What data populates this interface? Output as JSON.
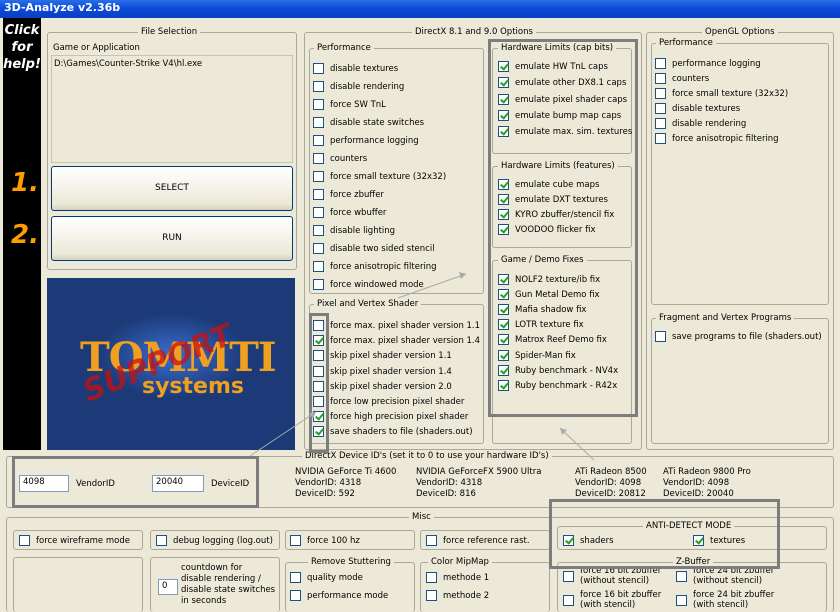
{
  "window": {
    "title": "3D-Analyze v2.36b"
  },
  "sidebar": {
    "help_lines": [
      "Click",
      "for",
      "help!"
    ],
    "step1": "1.",
    "step2": "2."
  },
  "file_selection": {
    "title": "File Selection",
    "label": "Game or Application",
    "path": "D:\\Games\\Counter-Strike V4\\hl.exe",
    "select_button": "SELECT",
    "run_button": "RUN"
  },
  "logo": {
    "main": "TOMMTI",
    "sub": "systems",
    "stamp": "SUPPORT"
  },
  "dx": {
    "title": "DirectX 8.1 and 9.0 Options",
    "performance": {
      "title": "Performance",
      "items": [
        {
          "label": "disable textures",
          "checked": false
        },
        {
          "label": "disable rendering",
          "checked": false
        },
        {
          "label": "force SW TnL",
          "checked": false
        },
        {
          "label": "disable state switches",
          "checked": false
        },
        {
          "label": "performance logging",
          "checked": false
        },
        {
          "label": "counters",
          "checked": false
        },
        {
          "label": "force small texture (32x32)",
          "checked": false
        },
        {
          "label": "force zbuffer",
          "checked": false
        },
        {
          "label": "force wbuffer",
          "checked": false
        },
        {
          "label": "disable lighting",
          "checked": false
        },
        {
          "label": "disable two sided stencil",
          "checked": false
        },
        {
          "label": "force anisotropic filtering",
          "checked": false
        },
        {
          "label": "force windowed mode",
          "checked": false
        }
      ]
    },
    "shader": {
      "title": "Pixel and Vertex Shader",
      "items": [
        {
          "label": "force max. pixel shader version 1.1",
          "checked": false
        },
        {
          "label": "force max. pixel shader version 1.4",
          "checked": true
        },
        {
          "label": "skip pixel shader version 1.1",
          "checked": false
        },
        {
          "label": "skip pixel shader version 1.4",
          "checked": false
        },
        {
          "label": "skip pixel shader version 2.0",
          "checked": false
        },
        {
          "label": "force low precision pixel shader",
          "checked": false
        },
        {
          "label": "force high precision pixel shader",
          "checked": true
        },
        {
          "label": "save shaders to file (shaders.out)",
          "checked": true
        }
      ]
    },
    "caps": {
      "title": "Hardware Limits (cap bits)",
      "items": [
        {
          "label": "emulate HW TnL caps",
          "checked": true
        },
        {
          "label": "emulate other DX8.1 caps",
          "checked": true
        },
        {
          "label": "emulate pixel shader caps",
          "checked": true
        },
        {
          "label": "emulate bump map caps",
          "checked": true
        },
        {
          "label": "emulate max. sim. textures",
          "checked": true
        }
      ]
    },
    "features": {
      "title": "Hardware Limits (features)",
      "items": [
        {
          "label": "emulate cube maps",
          "checked": true
        },
        {
          "label": "emulate DXT textures",
          "checked": true
        },
        {
          "label": "KYRO zbuffer/stencil fix",
          "checked": true
        },
        {
          "label": "VOODOO flicker fix",
          "checked": true
        }
      ]
    },
    "fixes": {
      "title": "Game / Demo Fixes",
      "items": [
        {
          "label": "NOLF2 texture/ib fix",
          "checked": true
        },
        {
          "label": "Gun Metal Demo fix",
          "checked": true
        },
        {
          "label": "Mafia shadow fix",
          "checked": true
        },
        {
          "label": "LOTR texture fix",
          "checked": true
        },
        {
          "label": "Matrox Reef Demo fix",
          "checked": true
        },
        {
          "label": "Spider-Man fix",
          "checked": true
        },
        {
          "label": "Ruby benchmark - NV4x",
          "checked": true
        },
        {
          "label": "Ruby benchmark - R42x",
          "checked": true
        }
      ]
    }
  },
  "opengl": {
    "title": "OpenGL Options",
    "performance": {
      "title": "Performance",
      "items": [
        {
          "label": "performance logging",
          "checked": false
        },
        {
          "label": "counters",
          "checked": false
        },
        {
          "label": "force small texture (32x32)",
          "checked": false
        },
        {
          "label": "disable textures",
          "checked": false
        },
        {
          "label": "disable rendering",
          "checked": false
        },
        {
          "label": "force anisotropic filtering",
          "checked": false
        }
      ]
    },
    "fragment": {
      "title": "Fragment and Vertex Programs",
      "items": [
        {
          "label": "save programs to file (shaders.out)",
          "checked": false
        }
      ]
    }
  },
  "device_ids": {
    "title": "DirectX Device ID's (set it to 0 to use your hardware ID's)",
    "vendor_value": "4098",
    "vendor_label": "VendorID",
    "device_value": "20040",
    "device_label": "DeviceID",
    "cards": [
      {
        "name": "NVIDIA GeForce Ti 4600",
        "vendor": "VendorID: 4318",
        "device": "DeviceID: 592"
      },
      {
        "name": "NVIDIA GeForceFX 5900 Ultra",
        "vendor": "VendorID: 4318",
        "device": "DeviceID: 816"
      },
      {
        "name": "ATi Radeon 8500",
        "vendor": "VendorID: 4098",
        "device": "DeviceID: 20812"
      },
      {
        "name": "ATi Radeon 9800 Pro",
        "vendor": "VendorID: 4098",
        "device": "DeviceID: 20040"
      }
    ]
  },
  "misc": {
    "title": "Misc",
    "wireframe": {
      "label": "force wireframe mode",
      "checked": false
    },
    "debug": {
      "label": "debug logging (log.out)",
      "checked": false
    },
    "hz": {
      "label": "force 100 hz",
      "checked": false
    },
    "refrast": {
      "label": "force reference rast.",
      "checked": false
    },
    "countdown": {
      "value": "0",
      "label_lines": [
        "countdown for",
        "disable rendering /",
        "disable state switches",
        "in seconds"
      ]
    },
    "stutter": {
      "title": "Remove Stuttering",
      "items": [
        {
          "label": "quality mode",
          "checked": false
        },
        {
          "label": "performance mode",
          "checked": false
        }
      ]
    },
    "mipmap": {
      "title": "Color MipMap",
      "items": [
        {
          "label": "methode 1",
          "checked": false
        },
        {
          "label": "methode 2",
          "checked": false
        }
      ]
    },
    "antidetect": {
      "title": "ANTI-DETECT MODE",
      "shaders": {
        "label": "shaders",
        "checked": true
      },
      "textures": {
        "label": "textures",
        "checked": true
      }
    },
    "zbuffer": {
      "title": "Z-Buffer",
      "items": [
        {
          "line1": "force 16 bit zbuffer",
          "line2": "(without stencil)",
          "checked": false
        },
        {
          "line1": "force 24 bit zbuffer",
          "line2": "(without stencil)",
          "checked": false
        },
        {
          "line1": "force 16 bit zbuffer",
          "line2": "(with stencil)",
          "checked": false
        },
        {
          "line1": "force 24 bit zbuffer",
          "line2": "(with stencil)",
          "checked": false
        }
      ]
    }
  }
}
